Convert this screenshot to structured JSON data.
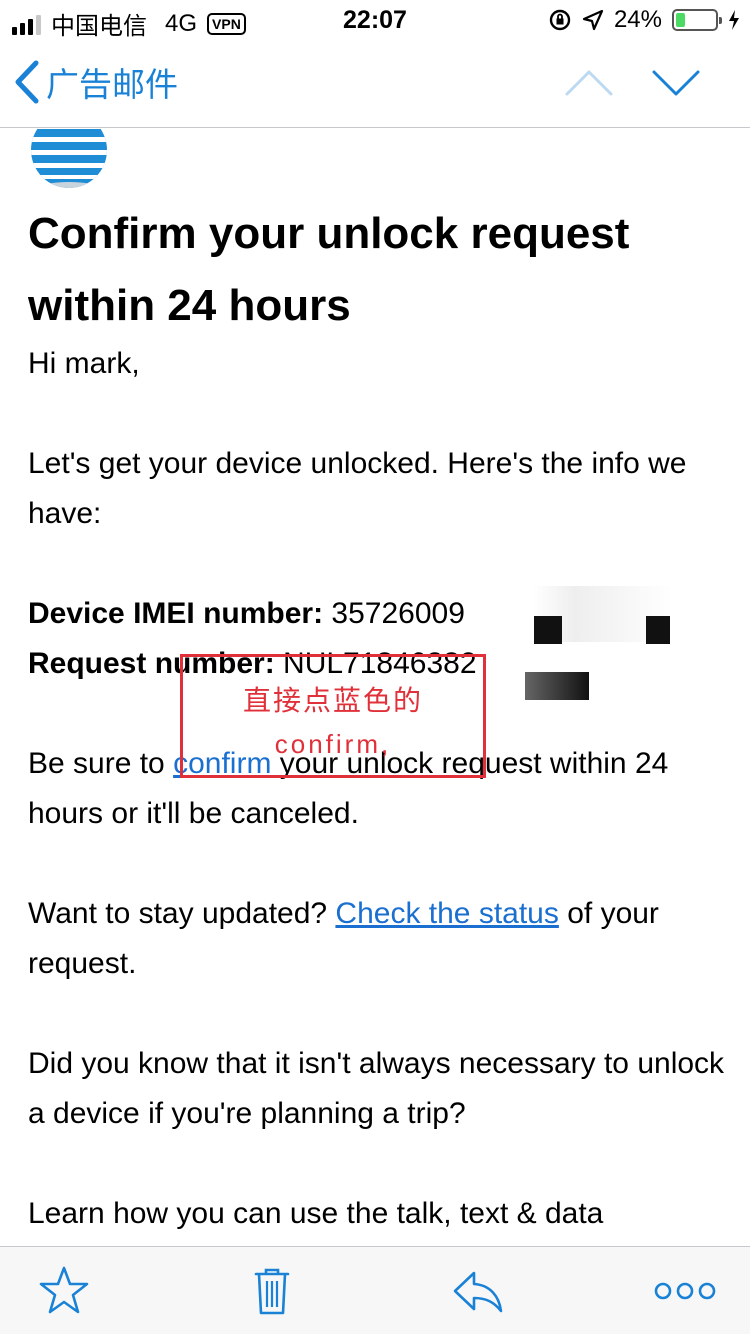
{
  "status_bar": {
    "carrier": "中国电信",
    "network": "4G",
    "vpn": "VPN",
    "time": "22:07",
    "battery_percent": "24%",
    "battery_level": 0.24
  },
  "nav": {
    "back_label": "广告邮件",
    "accent_color": "#1a82d6"
  },
  "email": {
    "title": "Confirm your unlock request within 24 hours",
    "greeting": "Hi mark,",
    "intro": "Let's get your device unlocked. Here's the info we have:",
    "imei_label": "Device IMEI number:",
    "imei_value": "35726009",
    "request_label": "Request number:",
    "request_value": "NUL71846382",
    "confirm_prefix": "Be sure to ",
    "confirm_link": "confirm",
    "confirm_suffix": " your unlock request within 24 hours or it'll be canceled.",
    "status_prefix": "Want to stay updated? ",
    "status_link": "Check the status",
    "status_suffix": " of your request.",
    "trip_text": "Did you know that it isn't always necessary to unlock a device if you're planning a trip?",
    "learn_text": "Learn how you can use the talk, text & data"
  },
  "annotation": {
    "line1": "直接点蓝色的",
    "line2": "confirm,"
  },
  "toolbar": {
    "icons": [
      "star-icon",
      "trash-icon",
      "reply-icon",
      "more-icon"
    ]
  }
}
